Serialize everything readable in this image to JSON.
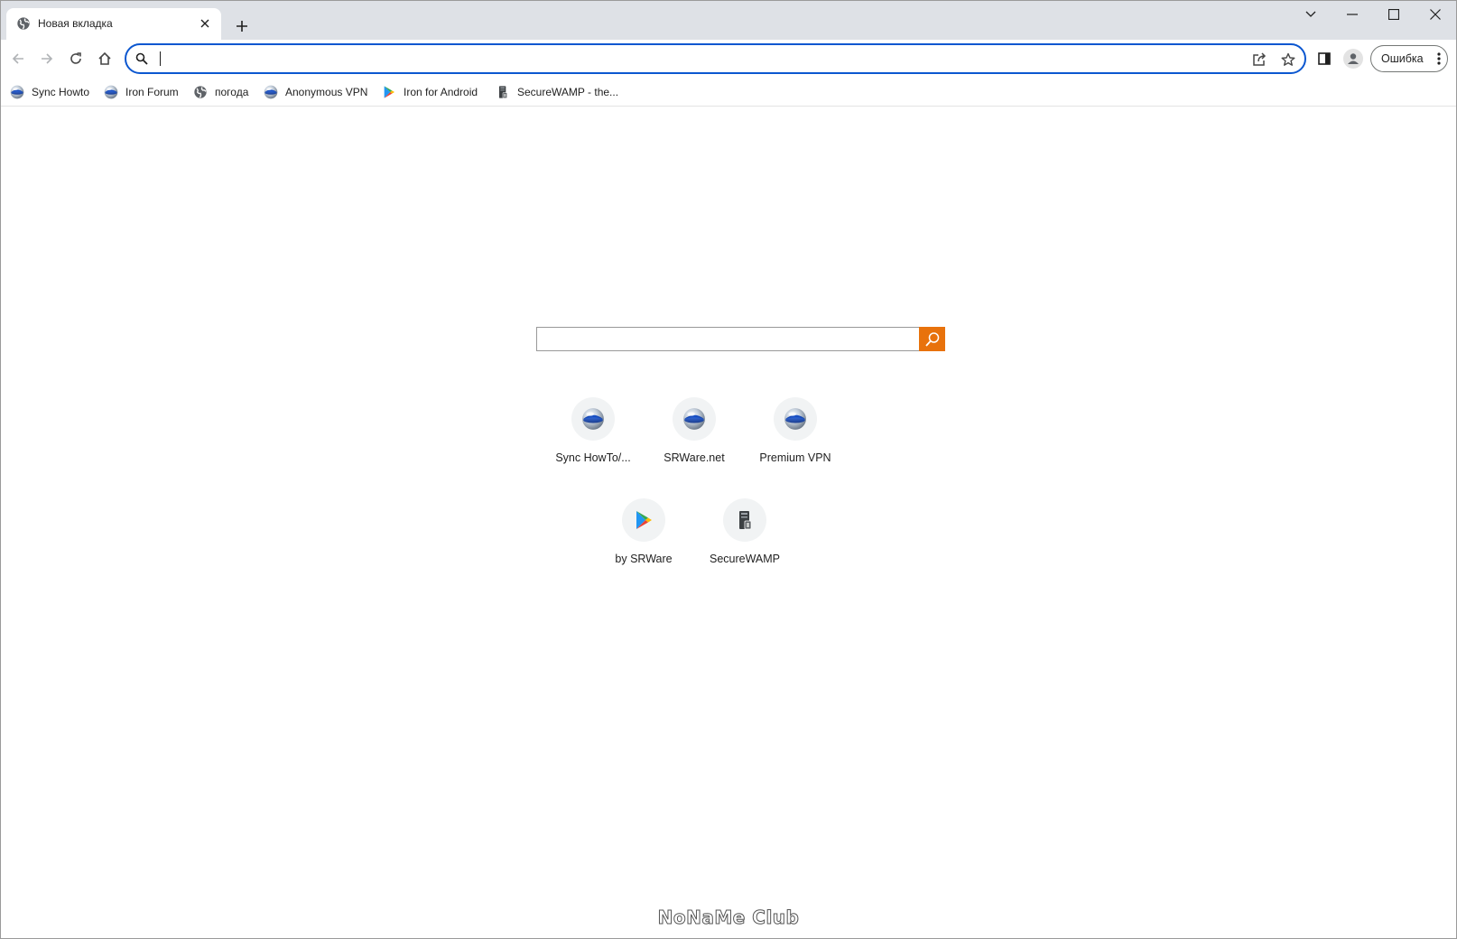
{
  "tab": {
    "title": "Новая вкладка",
    "favicon": "globe-icon"
  },
  "window_controls": [
    "tab-search-icon",
    "minimize-icon",
    "maximize-icon",
    "close-icon"
  ],
  "toolbar": {
    "omnibox_value": "",
    "icons": [
      "back-icon",
      "forward-icon",
      "reload-icon",
      "home-icon",
      "share-icon",
      "star-icon",
      "side-panel-icon",
      "profile-icon"
    ],
    "error_button": "Ошибка"
  },
  "bookmarks": [
    {
      "label": "Sync Howto",
      "icon": "iron-orb-icon"
    },
    {
      "label": "Iron Forum",
      "icon": "iron-orb-icon"
    },
    {
      "label": "погода",
      "icon": "globe-icon"
    },
    {
      "label": "Anonymous VPN",
      "icon": "iron-orb-icon"
    },
    {
      "label": "Iron for Android",
      "icon": "play-store-icon"
    },
    {
      "label": "SecureWAMP - the...",
      "icon": "server-icon"
    }
  ],
  "search": {
    "value": "",
    "button_icon": "search-icon",
    "button_color": "#e8720c"
  },
  "shortcuts": [
    {
      "label": "Sync HowTo/...",
      "icon": "iron-orb-icon"
    },
    {
      "label": "SRWare.net",
      "icon": "iron-orb-icon"
    },
    {
      "label": "Premium VPN",
      "icon": "iron-orb-icon"
    },
    {
      "label": "by SRWare",
      "icon": "play-store-icon"
    },
    {
      "label": "SecureWAMP",
      "icon": "server-icon"
    }
  ],
  "watermark": "NoNaMe Club",
  "colors": {
    "accent": "#0b57d0",
    "tabstrip": "#dee1e6",
    "search_button": "#e8720c"
  }
}
